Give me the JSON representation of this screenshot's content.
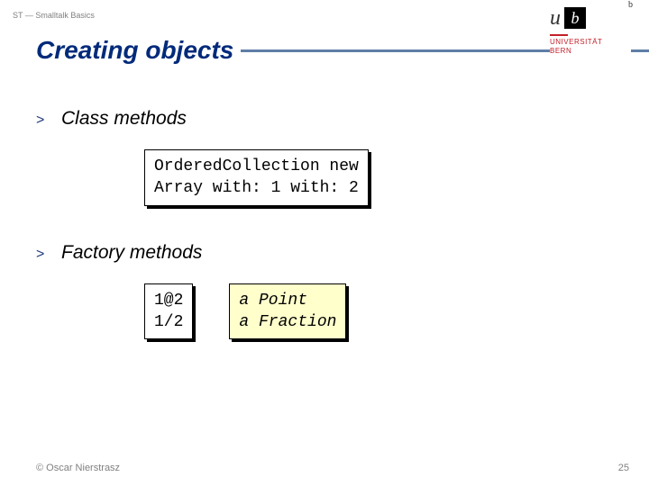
{
  "meta": {
    "breadcrumb": "ST — Smalltalk Basics"
  },
  "title": "Creating objects",
  "logo": {
    "u": "u",
    "b": "b",
    "sup": "b",
    "line1": "UNIVERSITÄT",
    "line2": "BERN"
  },
  "sections": [
    {
      "heading": "Class methods",
      "boxes": [
        {
          "kind": "white",
          "code": "OrderedCollection new\nArray with: 1 with: 2"
        }
      ]
    },
    {
      "heading": "Factory methods",
      "boxes": [
        {
          "kind": "white",
          "code": "1@2\n1/2"
        },
        {
          "kind": "yellow",
          "code": "a Point\na Fraction"
        }
      ]
    }
  ],
  "footer": {
    "copyright": "© Oscar Nierstrasz",
    "page": "25"
  }
}
